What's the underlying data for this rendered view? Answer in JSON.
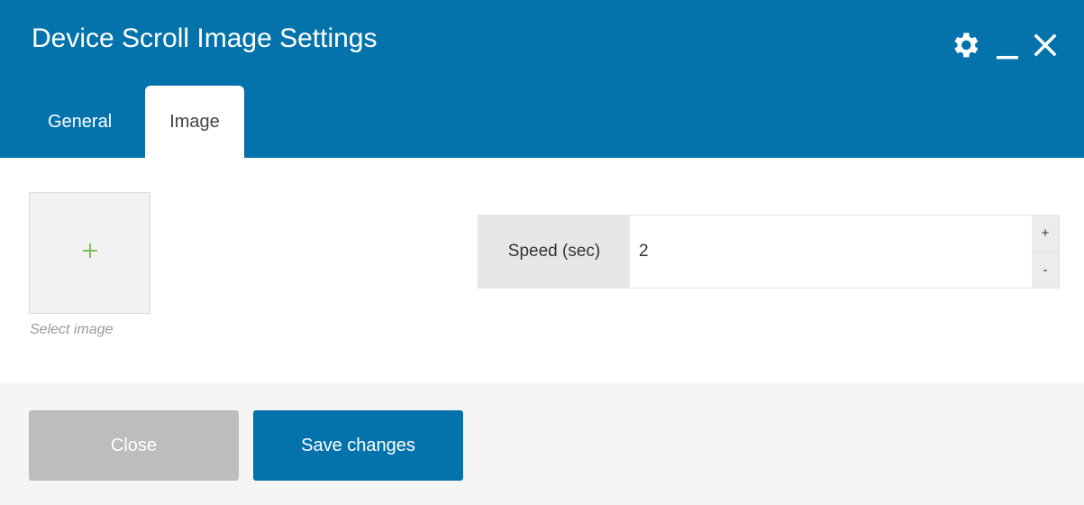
{
  "dialog": {
    "title": "Device Scroll Image Settings",
    "accent_color": "#0573ab",
    "controls": [
      {
        "icon": "gear-icon"
      },
      {
        "icon": "minimize-icon"
      },
      {
        "icon": "close-icon"
      }
    ]
  },
  "tabs": [
    {
      "label": "General",
      "active": false
    },
    {
      "label": "Image",
      "active": true
    }
  ],
  "image_picker": {
    "icon": "plus-icon",
    "caption": "Select image"
  },
  "speed": {
    "label": "Speed (sec)",
    "value": "2",
    "increment_label": "+",
    "decrement_label": "-"
  },
  "footer": {
    "close_label": "Close",
    "save_label": "Save changes"
  }
}
